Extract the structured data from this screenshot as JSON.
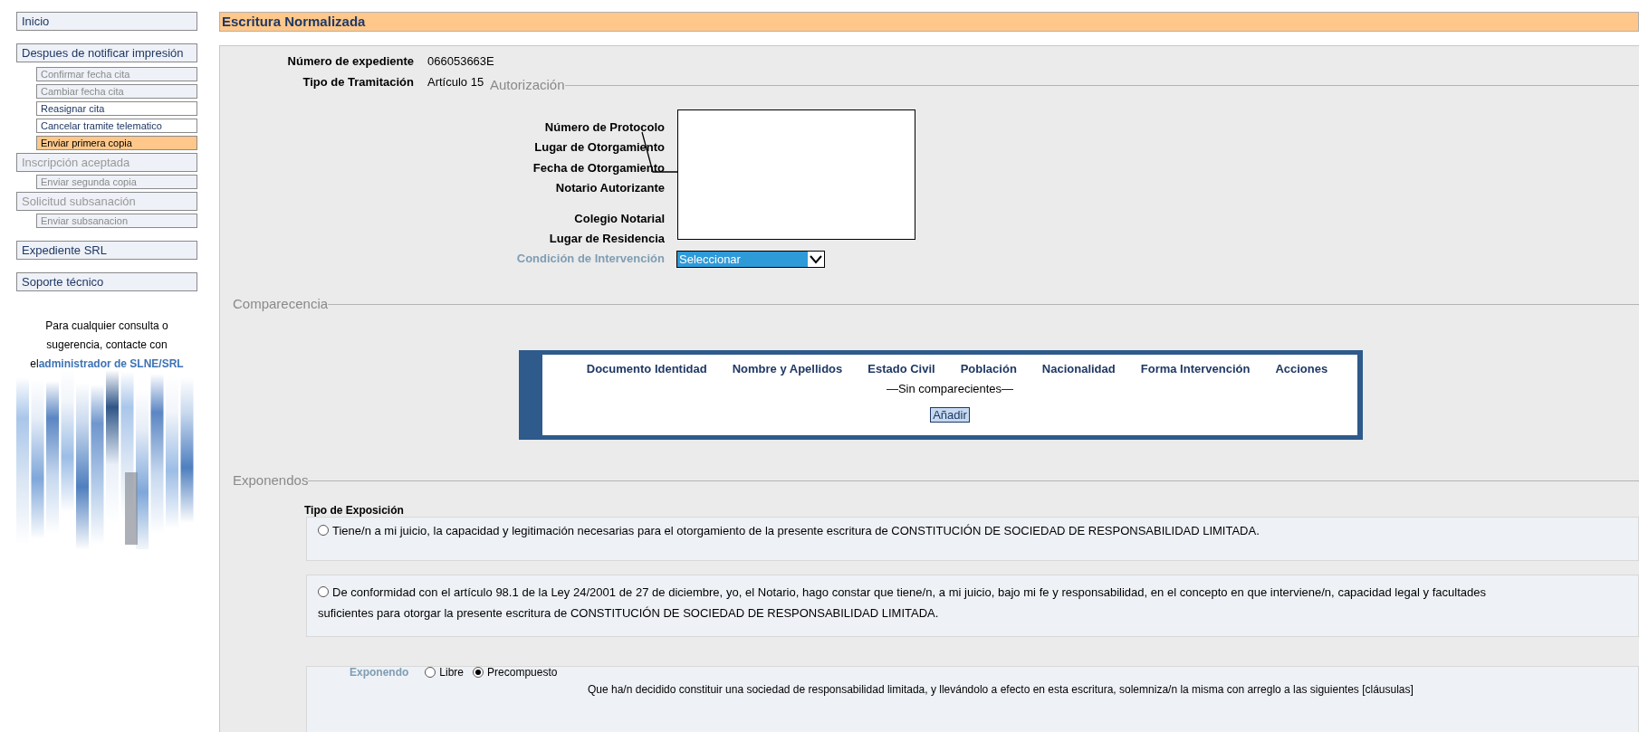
{
  "sidebar": {
    "items": [
      {
        "label": "Inicio",
        "kind": "section",
        "disabled": false,
        "selected": false
      },
      {
        "label": "Despues de notificar impresión",
        "kind": "section",
        "disabled": false,
        "selected": false
      },
      {
        "label": "Confirmar fecha cita",
        "kind": "item",
        "disabled": true,
        "selected": false
      },
      {
        "label": "Cambiar fecha cita",
        "kind": "item",
        "disabled": true,
        "selected": false
      },
      {
        "label": "Reasignar cita",
        "kind": "item",
        "disabled": false,
        "selected": false
      },
      {
        "label": "Cancelar tramite telematico",
        "kind": "item",
        "disabled": false,
        "selected": false
      },
      {
        "label": "Enviar primera copia",
        "kind": "item",
        "disabled": false,
        "selected": true
      },
      {
        "label": "Inscripción aceptada",
        "kind": "section",
        "disabled": true,
        "selected": false
      },
      {
        "label": "Enviar segunda copia",
        "kind": "item",
        "disabled": true,
        "selected": false
      },
      {
        "label": "Solicitud subsanación",
        "kind": "section",
        "disabled": true,
        "selected": false
      },
      {
        "label": "Enviar subsanacion",
        "kind": "item",
        "disabled": true,
        "selected": false
      },
      {
        "label": "Expediente SRL",
        "kind": "section",
        "disabled": false,
        "selected": false
      },
      {
        "label": "Soporte técnico",
        "kind": "section",
        "disabled": false,
        "selected": false
      }
    ],
    "support": {
      "text": "Para cualquier consulta o sugerencia, contacte con el",
      "link": "administrador de SLNE/SRL"
    }
  },
  "page_title": "Escritura Normalizada",
  "expediente": [
    {
      "label": "Número de expediente",
      "value": "066053663E"
    },
    {
      "label": "Tipo de Tramitación",
      "value": "Artículo 15"
    }
  ],
  "autorizacion": {
    "legend": "Autorización",
    "fields": [
      {
        "label": "Número de Protocolo"
      },
      {
        "label": "Lugar de Otorgamiento"
      },
      {
        "label": "Fecha de Otorgamiento"
      },
      {
        "label": "Notario Autorizante"
      },
      {
        "label": "Colegio Notarial",
        "spaced": true
      },
      {
        "label": "Lugar de Residencia"
      }
    ],
    "condicion": {
      "label": "Condición de Intervención",
      "value": "Seleccionar"
    }
  },
  "comparecencia": {
    "legend": "Comparecencia",
    "columns": [
      "Documento Identidad",
      "Nombre y Apellidos",
      "Estado Civil",
      "Población",
      "Nacionalidad",
      "Forma Intervención",
      "Acciones"
    ],
    "empty": "—Sin comparecientes—",
    "button": "Añadir"
  },
  "exponendos": {
    "legend": "Exponendos",
    "tipo_label": "Tipo de Exposición",
    "options": [
      {
        "text": "Tiene/n a mi juicio, la capacidad y legitimación necesarias para el otorgamiento de la presente escritura de CONSTITUCIÓN DE SOCIEDAD DE RESPONSABILIDAD LIMITADA.",
        "selected": false
      },
      {
        "text": "De conformidad con el artículo 98.1 de la Ley 24/2001 de 27 de diciembre, yo, el Notario, hago constar que tiene/n, a mi juicio, bajo mi fe y responsabilidad, en el concepto en que interviene/n, capacidad legal y facultades suficientes para otorgar la presente escritura de CONSTITUCIÓN DE SOCIEDAD DE RESPONSABILIDAD LIMITADA.",
        "selected": false
      }
    ],
    "exponendo": {
      "label": "Exponendo",
      "choices": [
        {
          "label": "Libre",
          "selected": false
        },
        {
          "label": "Precompuesto",
          "selected": true
        }
      ],
      "text": "Que ha/n decidido constituir una sociedad de responsabilidad limitada, y llevándolo a efecto en esta escritura, solemniza/n la misma con arreglo a las siguientes [cláusulas]"
    }
  }
}
